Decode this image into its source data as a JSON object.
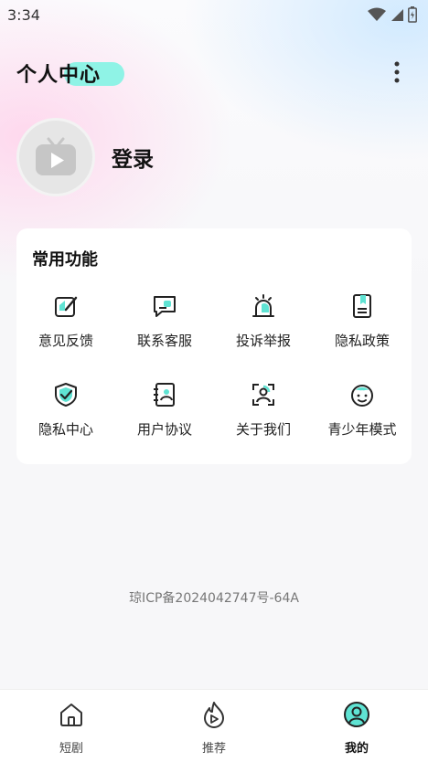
{
  "status_bar": {
    "time": "3:34"
  },
  "header": {
    "title": "个人中心"
  },
  "profile": {
    "login_label": "登录"
  },
  "features": {
    "title": "常用功能",
    "items": [
      {
        "label": "意见反馈",
        "icon": "feedback-edit-icon"
      },
      {
        "label": "联系客服",
        "icon": "chat-service-icon"
      },
      {
        "label": "投诉举报",
        "icon": "alarm-report-icon"
      },
      {
        "label": "隐私政策",
        "icon": "policy-book-icon"
      },
      {
        "label": "隐私中心",
        "icon": "shield-check-icon"
      },
      {
        "label": "用户协议",
        "icon": "agreement-doc-icon"
      },
      {
        "label": "关于我们",
        "icon": "about-person-scan-icon"
      },
      {
        "label": "青少年模式",
        "icon": "teen-face-icon"
      }
    ]
  },
  "footer": {
    "icp": "琼ICP备2024042747号-64A"
  },
  "bottom_nav": {
    "items": [
      {
        "label": "短剧",
        "icon": "home-icon"
      },
      {
        "label": "推荐",
        "icon": "fire-play-icon"
      },
      {
        "label": "我的",
        "icon": "profile-icon",
        "active": true
      }
    ]
  },
  "colors": {
    "accent": "#5fe3d3",
    "accent_light": "#8ff3e6",
    "text": "#111111"
  }
}
